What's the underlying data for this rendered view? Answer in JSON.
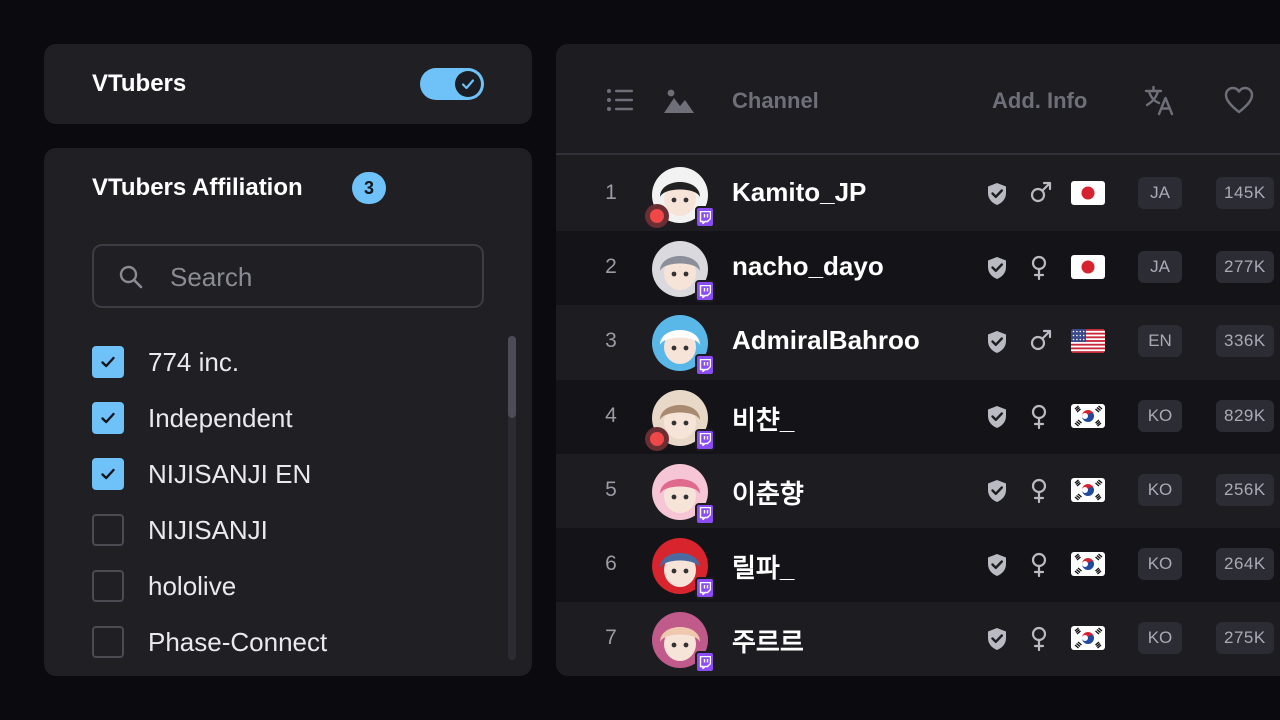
{
  "vtubers_toggle": {
    "label": "VTubers",
    "enabled": true,
    "accent": "#6ec2f7"
  },
  "affiliation": {
    "title": "VTubers Affiliation",
    "selected_count": "3",
    "search_placeholder": "Search",
    "options": [
      {
        "label": "774 inc.",
        "checked": true
      },
      {
        "label": "Independent",
        "checked": true
      },
      {
        "label": "NIJISANJI EN",
        "checked": true
      },
      {
        "label": "NIJISANJI",
        "checked": false
      },
      {
        "label": "hololive",
        "checked": false
      },
      {
        "label": "Phase-Connect",
        "checked": false
      }
    ]
  },
  "table": {
    "headers": {
      "channel": "Channel",
      "add_info": "Add. Info"
    },
    "header_icons": [
      "list-icon",
      "image-icon",
      "translate-icon",
      "heart-icon"
    ],
    "rows": [
      {
        "rank": "1",
        "name": "Kamito_JP",
        "live": true,
        "gender": "male",
        "country": "JP",
        "lang": "JA",
        "followers": "145K",
        "avatar_colors": [
          "#f2f2f2",
          "#222222"
        ]
      },
      {
        "rank": "2",
        "name": "nacho_dayo",
        "live": false,
        "gender": "female",
        "country": "JP",
        "lang": "JA",
        "followers": "277K",
        "avatar_colors": [
          "#d9d9de",
          "#8a8f99"
        ]
      },
      {
        "rank": "3",
        "name": "AdmiralBahroo",
        "live": false,
        "gender": "male",
        "country": "US",
        "lang": "EN",
        "followers": "336K",
        "avatar_colors": [
          "#5ab8e8",
          "#ffffff"
        ]
      },
      {
        "rank": "4",
        "name": "비챤_",
        "live": true,
        "gender": "female",
        "country": "KR",
        "lang": "KO",
        "followers": "829K",
        "avatar_colors": [
          "#e8d8c8",
          "#a88a70"
        ]
      },
      {
        "rank": "5",
        "name": "이춘향",
        "live": false,
        "gender": "female",
        "country": "KR",
        "lang": "KO",
        "followers": "256K",
        "avatar_colors": [
          "#f7c6d6",
          "#e06a8e"
        ]
      },
      {
        "rank": "6",
        "name": "릴파_",
        "live": false,
        "gender": "female",
        "country": "KR",
        "lang": "KO",
        "followers": "264K",
        "avatar_colors": [
          "#d8242c",
          "#4a6aa0"
        ]
      },
      {
        "rank": "7",
        "name": "주르르",
        "live": false,
        "gender": "female",
        "country": "KR",
        "lang": "KO",
        "followers": "275K",
        "avatar_colors": [
          "#c05a8a",
          "#f0c8b0"
        ]
      }
    ]
  }
}
